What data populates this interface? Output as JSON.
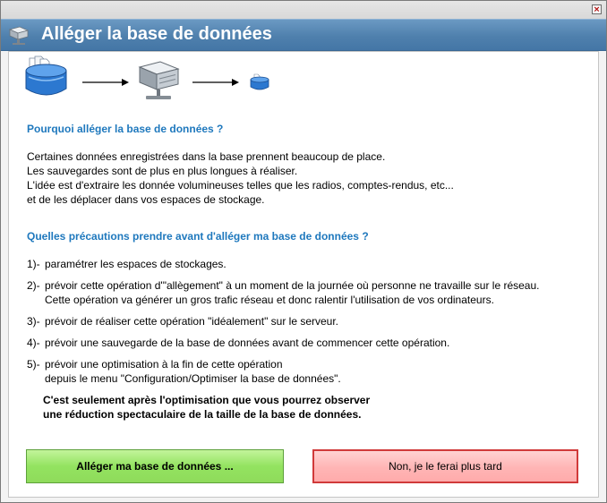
{
  "window": {
    "title": "Alléger la base de données",
    "close_glyph": "×"
  },
  "section1": {
    "heading": "Pourquoi alléger la base de données ?",
    "lines": [
      "Certaines données enregistrées dans la base prennent beaucoup de place.",
      "Les sauvegardes sont de plus en plus longues à réaliser.",
      "L'idée est d'extraire les donnée volumineuses telles que les radios, comptes-rendus, etc...",
      "et de les déplacer dans vos espaces de stockage."
    ]
  },
  "section2": {
    "heading": "Quelles précautions prendre avant d'alléger ma base de données ?",
    "items": [
      {
        "num": "1)-",
        "text": "paramétrer les espaces de stockages.",
        "cont": ""
      },
      {
        "num": "2)-",
        "text": "prévoir cette opération d'\"allègement\" à un moment de la journée où personne ne travaille sur le réseau.",
        "cont": "Cette opération va générer un gros trafic réseau et donc ralentir l'utilisation de vos ordinateurs."
      },
      {
        "num": "3)-",
        "text": "prévoir de réaliser cette opération \"idéalement\" sur le serveur.",
        "cont": ""
      },
      {
        "num": "4)-",
        "text": "prévoir une sauvegarde de la base de données avant de commencer cette opération.",
        "cont": ""
      },
      {
        "num": "5)-",
        "text": "prévoir une optimisation à la fin de cette opération",
        "cont": "depuis le menu \"Configuration/Optimiser la base de données\"."
      }
    ],
    "note_lines": [
      "C'est seulement après l'optimisation que vous pourrez observer",
      "une réduction spectaculaire de la taille de la base de données."
    ]
  },
  "buttons": {
    "confirm_label": "Alléger ma base de données ...",
    "cancel_label": "Non, je le ferai plus tard"
  },
  "colors": {
    "heading": "#1e78bd",
    "titlebar": "#4f80ad",
    "confirm_bg": "#93e360",
    "cancel_bg": "#ffb5b5"
  },
  "icons": [
    "database-icon",
    "arrow-right-icon",
    "server-icon",
    "small-database-icon"
  ]
}
